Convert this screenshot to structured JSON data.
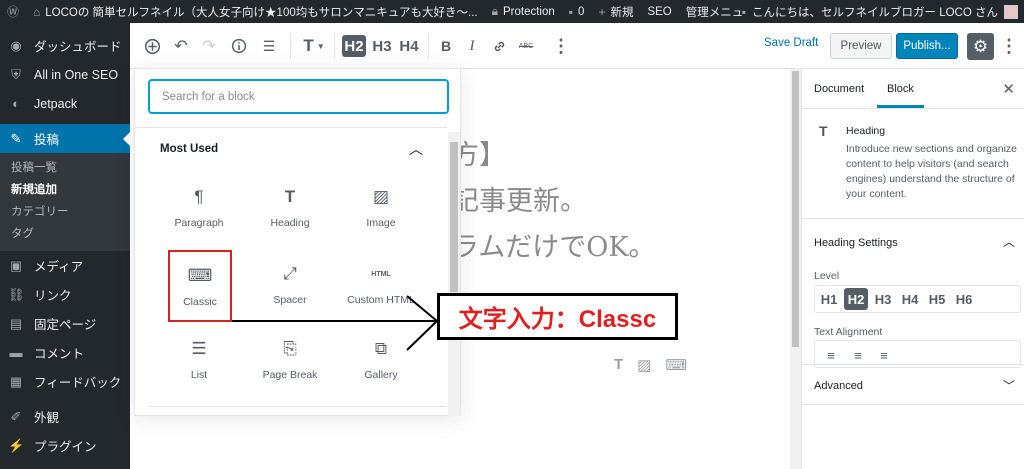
{
  "adminbar": {
    "site_title": "LOCOの 簡単セルフネイル（大人女子向け★100均もサロンマニキュアも大好き～...",
    "protection": "Protection",
    "comments_count": "0",
    "new_label": "新規",
    "seo_label": "SEO",
    "admin_menu": "管理メニュー",
    "greeting": "こんにちは、セルフネイルブロガー LOCO さん"
  },
  "sidebar": {
    "items": [
      {
        "label": "ダッシュボード",
        "icon": "dashboard-icon"
      },
      {
        "label": "All in One SEO",
        "icon": "shield-icon"
      },
      {
        "label": "Jetpack",
        "icon": "jetpack-icon"
      },
      {
        "label": "投稿",
        "icon": "pin-icon"
      },
      {
        "label": "メディア",
        "icon": "media-icon"
      },
      {
        "label": "リンク",
        "icon": "link-icon"
      },
      {
        "label": "固定ページ",
        "icon": "page-icon"
      },
      {
        "label": "コメント",
        "icon": "comment-icon"
      },
      {
        "label": "フィードバック",
        "icon": "feedback-icon"
      },
      {
        "label": "外観",
        "icon": "brush-icon"
      },
      {
        "label": "プラグイン",
        "icon": "plugin-icon"
      }
    ],
    "submenu": [
      "投稿一覧",
      "新規追加",
      "カテゴリー",
      "タグ"
    ]
  },
  "toolbar": {
    "save_draft": "Save Draft",
    "preview": "Preview",
    "publish": "Publish...",
    "heading_levels": [
      "H2",
      "H3",
      "H4"
    ],
    "strikethrough": "ABC"
  },
  "inserter": {
    "search_placeholder": "Search for a block",
    "section_title": "Most Used",
    "blocks": [
      {
        "label": "Paragraph",
        "icon": "paragraph-icon"
      },
      {
        "label": "Heading",
        "icon": "heading-icon"
      },
      {
        "label": "Image",
        "icon": "image-icon"
      },
      {
        "label": "Classic",
        "icon": "keyboard-icon"
      },
      {
        "label": "Spacer",
        "icon": "resize-icon"
      },
      {
        "label": "Custom HTML",
        "icon": "html-icon"
      },
      {
        "label": "List",
        "icon": "list-icon"
      },
      {
        "label": "Page Break",
        "icon": "page-break-icon"
      },
      {
        "label": "Gallery",
        "icon": "gallery-icon"
      }
    ],
    "html_icon_text": "HTML"
  },
  "content": {
    "line1": "方】",
    "line2": "記事更新。",
    "line3": "ラムだけでOK。"
  },
  "panel": {
    "tab_document": "Document",
    "tab_block": "Block",
    "block_title": "Heading",
    "block_desc": "Introduce new sections and organize content to help visitors (and search engines) understand the structure of your content.",
    "heading_settings": "Heading Settings",
    "level_label": "Level",
    "levels": [
      "H1",
      "H2",
      "H3",
      "H4",
      "H5",
      "H6"
    ],
    "text_alignment": "Text Alignment",
    "advanced": "Advanced"
  },
  "annotation": {
    "text": "文字入力：Classc",
    "color": "#e02020"
  },
  "colors": {
    "admin_bg": "#23282d",
    "accent": "#0073aa",
    "publish": "#0085ba",
    "highlight": "#d62424"
  }
}
